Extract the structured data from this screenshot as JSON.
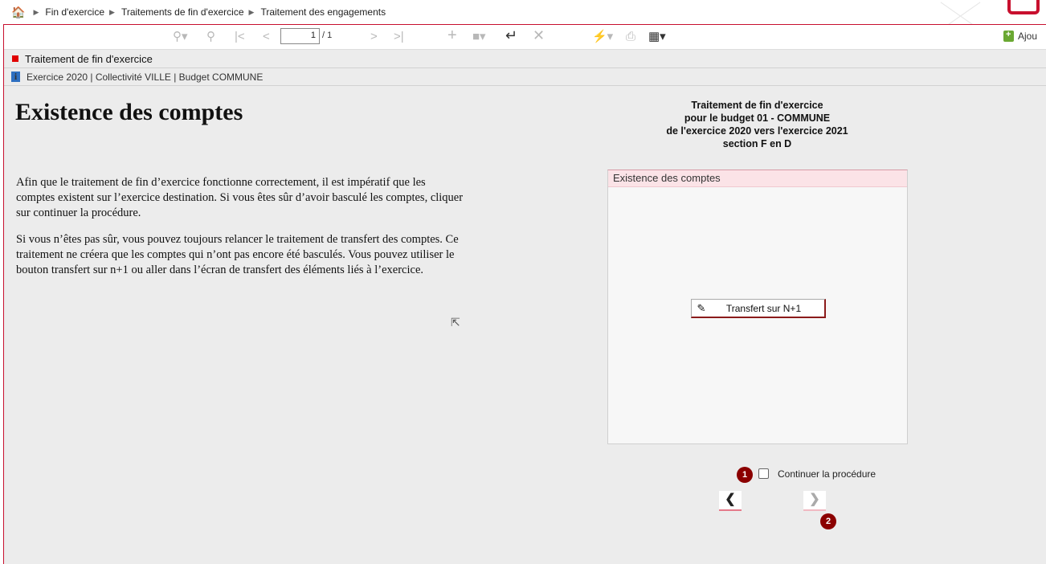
{
  "breadcrumb": {
    "items": [
      "Fin d'exercice",
      "Traitements de fin d'exercice",
      "Traitement des engagements"
    ]
  },
  "toolbar": {
    "page_current": "1",
    "page_total": "/ 1",
    "ajout_label": "Ajou",
    "icons": [
      "search-icon",
      "zoom-icon",
      "first-page-icon",
      "prev-page-icon",
      "next-page-icon",
      "last-page-icon",
      "add-icon",
      "save-icon",
      "undo-icon",
      "cancel-icon",
      "flash-icon",
      "print-icon",
      "settings-icon"
    ]
  },
  "header": {
    "title": "Traitement de fin d'exercice",
    "context": "Exercice 2020 | Collectivité VILLE | Budget COMMUNE"
  },
  "main": {
    "heading": "Existence des comptes",
    "paragraph1": "Afin que le traitement de fin d’exercice fonctionne correctement, il est impératif que les comptes existent sur l’exercice destination. Si vous êtes sûr d’avoir basculé les comptes, cliquer sur continuer la procédure.",
    "paragraph2": "Si vous n’êtes pas sûr, vous pouvez toujours relancer le traitement de transfert des comptes. Ce traitement ne créera que les comptes qui n’ont pas encore été basculés. Vous pouvez utiliser le bouton transfert sur n+1 ou aller dans l’écran de transfert des éléments liés à l’exercice."
  },
  "summary": {
    "line1": "Traitement de fin d'exercice",
    "line2": "pour le budget 01 - COMMUNE",
    "line3": "de l'exercice 2020 vers l'exercice 2021",
    "line4": "section F en D"
  },
  "panel": {
    "title": "Existence des comptes",
    "button_label": "Transfert sur N+1"
  },
  "controls": {
    "continue_label": "Continuer la procédure",
    "continue_checked": false,
    "badge1": "1",
    "badge2": "2"
  },
  "colors": {
    "accent": "#c8102e",
    "badge": "#8b0000",
    "panel_header": "#fbe3e7",
    "background": "#ececec"
  }
}
